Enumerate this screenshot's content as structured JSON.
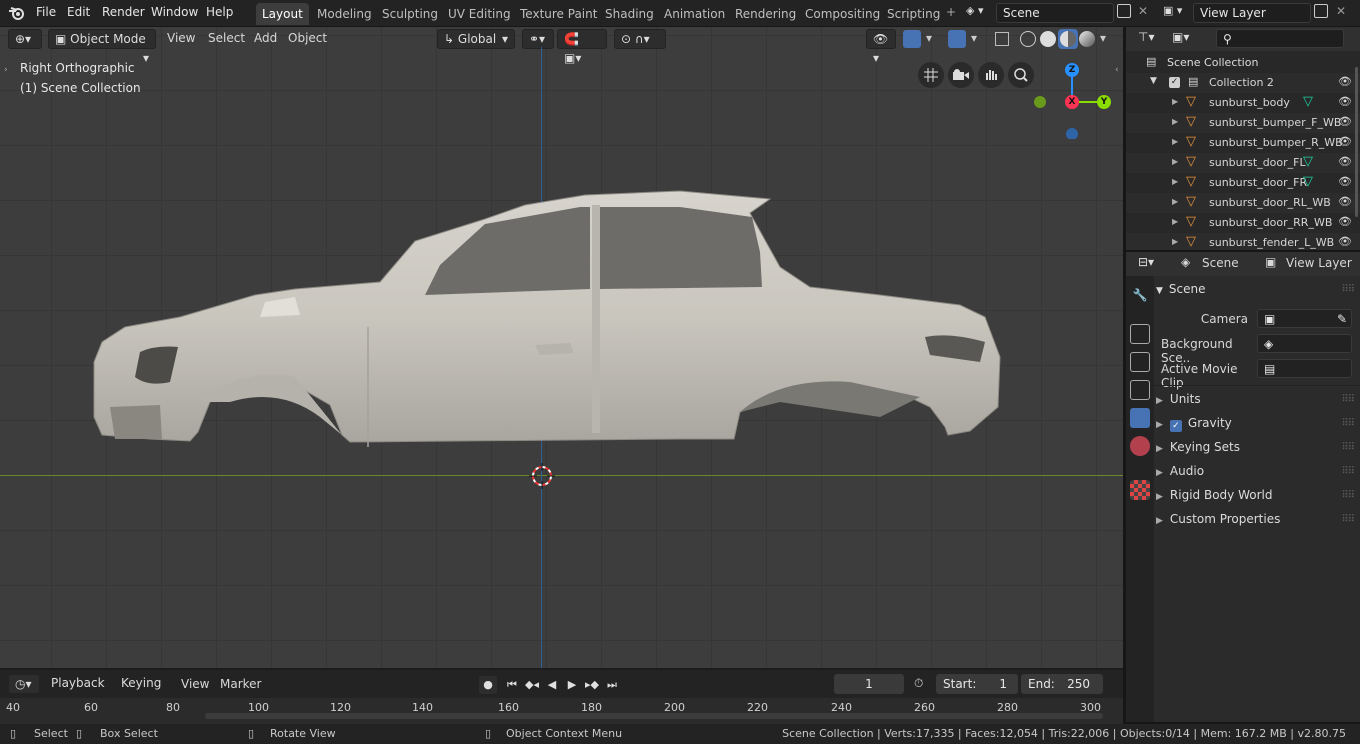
{
  "menu": [
    "File",
    "Edit",
    "Render",
    "Window",
    "Help"
  ],
  "workspaces": [
    "Layout",
    "Modeling",
    "Sculpting",
    "UV Editing",
    "Texture Paint",
    "Shading",
    "Animation",
    "Rendering",
    "Compositing",
    "Scripting"
  ],
  "scene_name": "Scene",
  "view_layer_name": "View Layer",
  "viewport": {
    "mode": "Object Mode",
    "menus": [
      "View",
      "Select",
      "Add",
      "Object"
    ],
    "orientation": "Global",
    "view_name": "Right Orthographic",
    "collection_label": "(1) Scene Collection",
    "gizmo": {
      "z": "Z",
      "x": "X",
      "y": "Y"
    }
  },
  "outliner": {
    "root": "Scene Collection",
    "collection": "Collection 2",
    "objects": [
      "sunburst_body",
      "sunburst_bumper_F_WB",
      "sunburst_bumper_R_WB",
      "sunburst_door_FL",
      "sunburst_door_FR",
      "sunburst_door_RL_WB",
      "sunburst_door_RR_WB",
      "sunburst_fender_L_WB"
    ]
  },
  "properties": {
    "header_scene": "Scene",
    "header_view_layer": "View Layer",
    "panel_title": "Scene",
    "camera_label": "Camera",
    "background_label": "Background Sce..",
    "movie_clip_label": "Active Movie Clip",
    "sections": [
      "Units",
      "Gravity",
      "Keying Sets",
      "Audio",
      "Rigid Body World",
      "Custom Properties"
    ]
  },
  "timeline": {
    "menus": [
      "Playback",
      "Keying",
      "View",
      "Marker"
    ],
    "current_frame": "1",
    "start_label": "Start:",
    "start": "1",
    "end_label": "End:",
    "end": "250",
    "ruler": [
      "40",
      "60",
      "80",
      "100",
      "120",
      "140",
      "160",
      "180",
      "200",
      "220",
      "240",
      "260",
      "280",
      "300"
    ]
  },
  "status": {
    "select": "Select",
    "box_select": "Box Select",
    "rotate": "Rotate View",
    "context": "Object Context Menu",
    "stats": "Scene Collection | Verts:17,335 | Faces:12,054 | Tris:22,006 | Objects:0/14 | Mem: 167.2 MB | v2.80.75"
  },
  "colors": {
    "accent": "#4772b3",
    "x_axis": "#ff3352",
    "y_axis": "#8bdc00",
    "z_axis": "#2890ff",
    "object_icon": "#e7913a",
    "mesh_data": "#1dd3a0"
  }
}
